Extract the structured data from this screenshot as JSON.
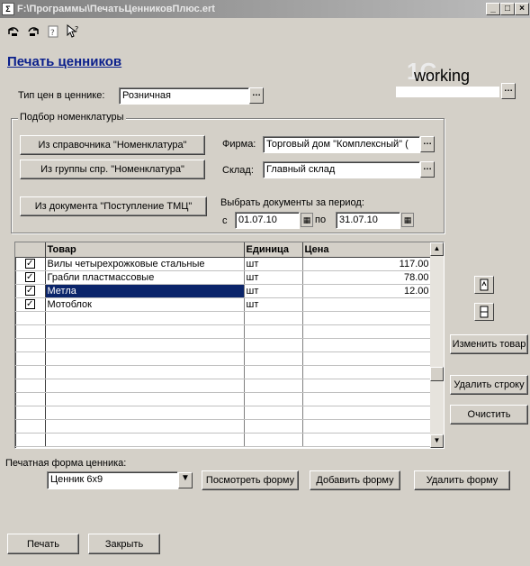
{
  "window": {
    "title": "F:\\Программы\\ПечатьЦенниковПлюс.ert",
    "controls": [
      "_",
      "□",
      "×"
    ]
  },
  "toolbar": {
    "icons": [
      "undo-icon",
      "redo-icon",
      "help-icon",
      "pointer-help-icon"
    ]
  },
  "header": {
    "title": "Печать ценников",
    "logo_text": "working"
  },
  "price_type": {
    "label": "Тип цен в ценнике:",
    "value": "Розничная"
  },
  "group": {
    "title": "Подбор номенклатуры",
    "btn_catalog": "Из справочника \"Номенклатура\"",
    "btn_group": "Из группы спр. \"Номенклатура\"",
    "btn_document": "Из документа \"Поступление ТМЦ\"",
    "firm_label": "Фирма:",
    "firm_value": "Торговый дом \"Комплексный\" (",
    "warehouse_label": "Склад:",
    "warehouse_value": "Главный склад",
    "period_label": "Выбрать документы за период:",
    "from_label": "с",
    "from_value": "01.07.10",
    "to_label": "по",
    "to_value": "31.07.10"
  },
  "grid": {
    "columns": [
      "",
      "Товар",
      "Единица",
      "Цена"
    ],
    "rows": [
      {
        "checked": true,
        "name": "Вилы четырехрожковые стальные",
        "unit": "шт",
        "price": "117.00"
      },
      {
        "checked": true,
        "name": "Грабли пластмассовые",
        "unit": "шт",
        "price": "78.00"
      },
      {
        "checked": true,
        "name": "Метла",
        "unit": "шт",
        "price": "12.00",
        "selected": true
      },
      {
        "checked": true,
        "name": "Мотоблок",
        "unit": "шт",
        "price": ""
      }
    ],
    "empty_rows": 10
  },
  "side": {
    "btn_edit": "Изменить товар",
    "btn_delete": "Удалить строку",
    "btn_clear": "Очистить"
  },
  "print_form": {
    "label": "Печатная форма ценника:",
    "value": "Ценник 6х9",
    "btn_view": "Посмотреть форму",
    "btn_add": "Добавить форму",
    "btn_delete": "Удалить форму"
  },
  "footer": {
    "btn_print": "Печать",
    "btn_close": "Закрыть"
  }
}
